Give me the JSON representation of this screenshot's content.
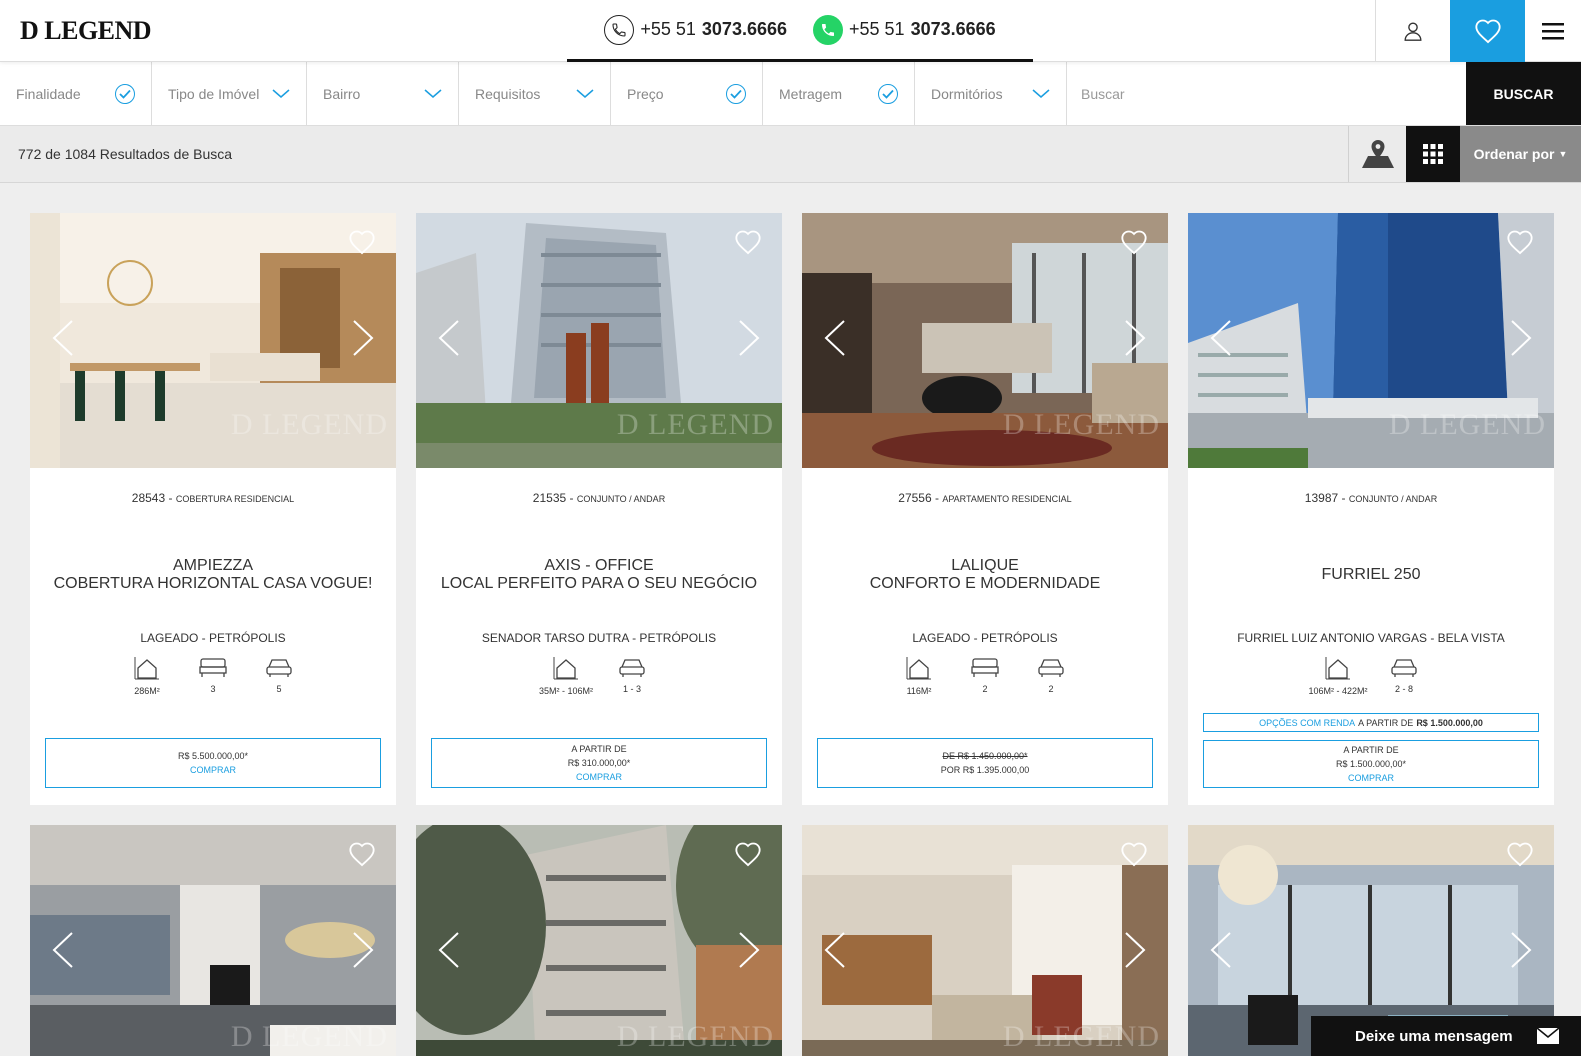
{
  "header": {
    "logo": "D LEGEND",
    "phone": {
      "prefix": "+55 51",
      "number": "3073.6666"
    },
    "whatsapp": {
      "prefix": "+55 51",
      "number": "3073.6666"
    },
    "colors": {
      "accent": "#1a9ee0",
      "dark": "#111111",
      "whatsapp": "#25d366"
    }
  },
  "filters": {
    "items": [
      {
        "label": "Finalidade",
        "icon": "check-circle-icon"
      },
      {
        "label": "Tipo de Imóvel",
        "icon": "chevron-down-icon"
      },
      {
        "label": "Bairro",
        "icon": "chevron-down-icon"
      },
      {
        "label": "Requisitos",
        "icon": "chevron-down-icon"
      },
      {
        "label": "Preço",
        "icon": "check-circle-icon"
      },
      {
        "label": "Metragem",
        "icon": "check-circle-icon"
      },
      {
        "label": "Dormitórios",
        "icon": "chevron-down-icon"
      }
    ],
    "search_placeholder": "Buscar",
    "search_button": "BUSCAR"
  },
  "results": {
    "count_text": "772 de 1084 Resultados de Busca",
    "sort_label": "Ordenar por"
  },
  "watermark": "D LEGEND",
  "cards": [
    {
      "code": "28543",
      "type": "COBERTURA RESIDENCIAL",
      "title_line1": "AMPIEZZA",
      "title_line2": "COBERTURA HORIZONTAL CASA VOGUE!",
      "location": "LAGEADO - PETRÓPOLIS",
      "specs": {
        "area": "286M²",
        "beds": "3",
        "cars": "5"
      },
      "price_line1": "R$ 5.500.000,00*",
      "buy": "COMPRAR",
      "photo_colors": [
        "#e8d9c4",
        "#b58a5a",
        "#f4ede3"
      ]
    },
    {
      "code": "21535",
      "type": "CONJUNTO / ANDAR",
      "title_line1": "AXIS - OFFICE",
      "title_line2": "LOCAL PERFEITO PARA O SEU NEGÓCIO",
      "location": "SENADOR TARSO DUTRA - PETRÓPOLIS",
      "specs": {
        "area": "35M² - 106M²",
        "cars": "1 - 3"
      },
      "price_line0": "A PARTIR DE",
      "price_line1": "R$ 310.000,00*",
      "buy": "COMPRAR",
      "photo_colors": [
        "#c9d3dc",
        "#8a939c",
        "#5e7a4a"
      ]
    },
    {
      "code": "27556",
      "type": "APARTAMENTO RESIDENCIAL",
      "title_line1": "LALIQUE",
      "title_line2": "CONFORTO E MODERNIDADE",
      "location": "LAGEADO - PETRÓPOLIS",
      "specs": {
        "area": "116M²",
        "beds": "2",
        "cars": "2"
      },
      "price_old": "DE R$ 1.450.000,00*",
      "price_new": "POR R$ 1.395.000,00",
      "photo_colors": [
        "#6b5848",
        "#a7927b",
        "#3a2f27"
      ]
    },
    {
      "code": "13987",
      "type": "CONJUNTO / ANDAR",
      "title_line1": "FURRIEL 250",
      "title_line2": "",
      "location": "FURRIEL LUIZ ANTONIO VARGAS - BELA VISTA",
      "specs": {
        "area": "106M² - 422M²",
        "cars": "2 - 8"
      },
      "renda_accent": "OPÇÕES COM RENDA",
      "renda_text": "A PARTIR DE",
      "renda_price": "R$ 1.500.000,00",
      "price_line0": "A PARTIR DE",
      "price_line1": "R$ 1.500.000,00*",
      "buy": "COMPRAR",
      "photo_colors": [
        "#4f7fc4",
        "#1d3f7a",
        "#c6ccd3"
      ]
    }
  ],
  "row2_colors": [
    [
      "#8a8d90",
      "#4a4c4e",
      "#c8c4bd"
    ],
    [
      "#8e948a",
      "#4f5a48",
      "#c4c0b8"
    ],
    [
      "#cfc4b3",
      "#8a6e55",
      "#e9e2d6"
    ],
    [
      "#b8c2cc",
      "#5c6670",
      "#e2d9c8"
    ]
  ],
  "chat": {
    "label": "Deixe uma mensagem"
  }
}
